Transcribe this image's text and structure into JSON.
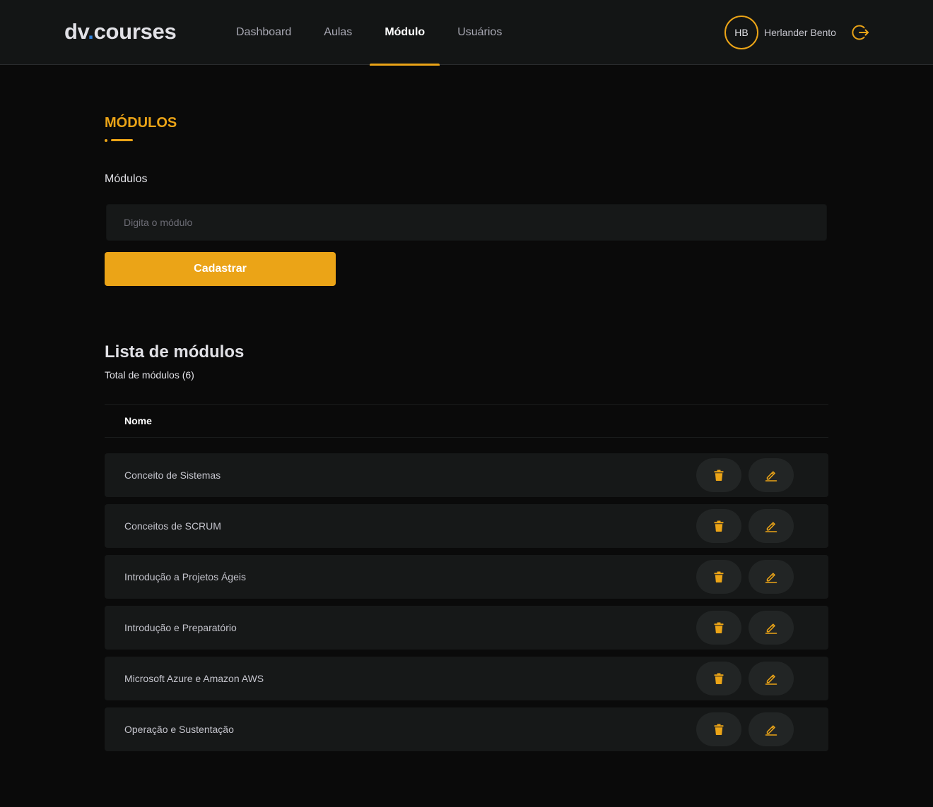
{
  "header": {
    "logo_prefix": "dv",
    "logo_dot": ".",
    "logo_suffix": "courses",
    "nav": [
      {
        "label": "Dashboard",
        "active": false
      },
      {
        "label": "Aulas",
        "active": false
      },
      {
        "label": "Módulo",
        "active": true
      },
      {
        "label": "Usuários",
        "active": false
      }
    ],
    "user": {
      "initials": "HB",
      "name": "Herlander Bento"
    }
  },
  "form": {
    "section_title": "MÓDULOS",
    "field_label": "Módulos",
    "input_value": "",
    "input_placeholder": "Digita o módulo",
    "submit_label": "Cadastrar"
  },
  "list": {
    "title": "Lista de módulos",
    "count_text": "Total de módulos (6)",
    "column_name": "Nome",
    "rows": [
      {
        "name": "Conceito de Sistemas"
      },
      {
        "name": "Conceitos de SCRUM"
      },
      {
        "name": "Introdução a Projetos Ágeis"
      },
      {
        "name": "Introdução e Preparatório"
      },
      {
        "name": "Microsoft Azure e Amazon AWS"
      },
      {
        "name": "Operação e Sustentação"
      }
    ]
  },
  "icons": {
    "logout": "logout-icon",
    "delete": "trash-icon",
    "edit": "pencil-icon"
  },
  "colors": {
    "accent": "#eba417",
    "logo_dot": "#2e7fd9",
    "background": "#0a0a0a",
    "surface": "#161818",
    "header": "#131515",
    "icon_button": "#222525"
  }
}
